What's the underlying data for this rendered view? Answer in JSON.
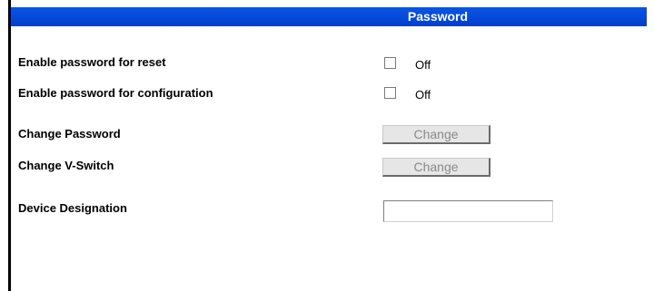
{
  "header": {
    "title": "Password",
    "color": "#0047d6"
  },
  "settings": {
    "reset_password": {
      "label": "Enable password for reset",
      "checked": false,
      "state_text": "Off"
    },
    "config_password": {
      "label": "Enable password for configuration",
      "checked": false,
      "state_text": "Off"
    },
    "change_password": {
      "label": "Change Password",
      "button_label": "Change"
    },
    "change_vswitch": {
      "label": "Change V-Switch",
      "button_label": "Change"
    },
    "device_designation": {
      "label": "Device Designation",
      "value": ""
    }
  }
}
